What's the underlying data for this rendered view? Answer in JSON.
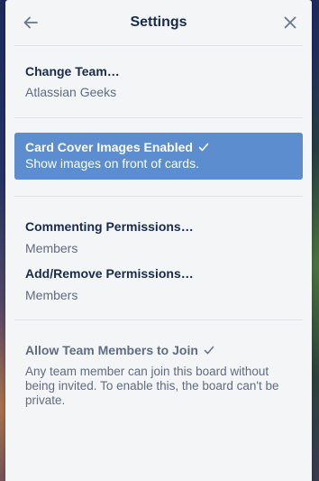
{
  "header": {
    "title": "Settings",
    "back_icon": "arrow-left-icon",
    "close_icon": "close-icon"
  },
  "team": {
    "title": "Change Team…",
    "value": "Atlassian Geeks"
  },
  "card_cover": {
    "title": "Card Cover Images Enabled",
    "description": "Show images on front of cards.",
    "checked": true,
    "color": "#5b8dcf"
  },
  "permissions": {
    "commenting_title": "Commenting Permissions…",
    "commenting_value": "Members",
    "add_remove_title": "Add/Remove Permissions…",
    "add_remove_value": "Members"
  },
  "team_join": {
    "title": "Allow Team Members to Join",
    "description": "Any team member can join this board without being invited. To enable this, the board can't be private.",
    "checked": true
  }
}
